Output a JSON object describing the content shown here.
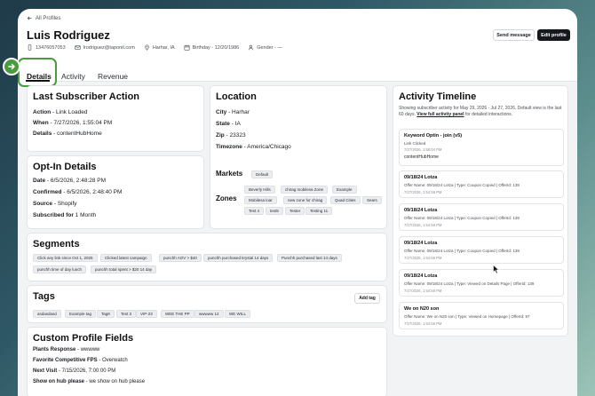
{
  "nav": {
    "back_label": "All Profiles"
  },
  "profile": {
    "name": "Luis Rodriguez",
    "phone": "13476057053",
    "email": "lrodriguez@taponit.com",
    "location": "Harhar, IA",
    "birthday": "Birthday - 12/20/1986",
    "gender": "Gender - —"
  },
  "actions": {
    "send_message": "Send message",
    "edit_profile": "Edit profile"
  },
  "tabs": [
    {
      "label": "Details"
    },
    {
      "label": "Activity"
    },
    {
      "label": "Revenue"
    }
  ],
  "last_action": {
    "title": "Last Subscriber Action",
    "rows": [
      {
        "key": "Action",
        "value": " - Link Loaded"
      },
      {
        "key": "When",
        "value": " - 7/27/2026, 1:55:04 PM"
      },
      {
        "key": "Details",
        "value": " - contentHubHome"
      }
    ]
  },
  "optin": {
    "title": "Opt-In Details",
    "rows": [
      {
        "key": "Date",
        "value": " - 6/5/2026, 2:48:28 PM"
      },
      {
        "key": "Confirmed",
        "value": " - 6/5/2026, 2:48:40 PM"
      },
      {
        "key": "Source",
        "value": " - Shopify"
      },
      {
        "key": "Subscribed for",
        "value": " 1 Month"
      }
    ]
  },
  "location": {
    "title": "Location",
    "rows": [
      {
        "key": "City",
        "value": " - Harhar"
      },
      {
        "key": "State",
        "value": " - IA"
      },
      {
        "key": "Zip",
        "value": " - 23323"
      },
      {
        "key": "Timezone",
        "value": " - America/Chicago"
      }
    ],
    "markets_label": "Markets",
    "markets": [
      "Default"
    ],
    "zones_label": "Zones",
    "zones": [
      "Beverly Hills",
      "chirag mobilesa Zone",
      "Example",
      "Mobilesa loar",
      "new zone for chirag",
      "Quad Cities",
      "Sears",
      "Test 4",
      "test5",
      "Tester",
      "Testing 11"
    ]
  },
  "segments": {
    "title": "Segments",
    "items": [
      "Click any link since Oct 1, 2025",
      "Clicked latest campaign",
      "punchh AOV > $40",
      "punchh purchased krystal 14 days",
      "Punchh purchased last 14 days",
      "punchh time of day lunch",
      "punchh total spent > $20 14 day"
    ]
  },
  "tags": {
    "title": "Tags",
    "add_label": "Add tag",
    "items": [
      "asdasdasd",
      "Example tag",
      "Tag8",
      "Test 3",
      "VIP-23",
      "WEE THE PP",
      "wwwww 12",
      "WE WILL"
    ]
  },
  "custom": {
    "title": "Custom Profile Fields",
    "rows": [
      {
        "key": "Plants Response",
        "value": " - wwwww"
      },
      {
        "key": "Favorite Competitive FPS",
        "value": " - Overwatch"
      },
      {
        "key": "Next Visit",
        "value": " - 7/15/2026, 7:00:00 PM"
      },
      {
        "key": "Show on hub please",
        "value": " - we show on hub please"
      }
    ]
  },
  "timeline": {
    "title": "Activity Timeline",
    "desc_prefix": "Showing subscriber activity for May 29, 2026 - Jul 27, 2026. Default view is the last 60 days. ",
    "desc_link": "View full activity panel",
    "desc_suffix": " for detailed interactions.",
    "items": [
      {
        "title": "Keyword Optin - join (v5)",
        "lines": [
          "Link Clicked",
          "7/27/2026, 1:55:04 PM",
          "contentHubHome"
        ]
      },
      {
        "title": "09/18/24 Lotza",
        "lines": [
          "Offer Name: 09/18/24 Lotza | Type: Coupon Copied | OfferId: 139",
          "7/27/2026, 1:54:58 PM"
        ]
      },
      {
        "title": "09/18/24 Lotza",
        "lines": [
          "Offer Name: 09/18/24 Lotza | Type: Coupon Copied | OfferId: 139",
          "7/27/2026, 1:54:58 PM"
        ]
      },
      {
        "title": "09/18/24 Lotza",
        "lines": [
          "Offer Name: 09/18/24 Lotza | Type: Coupon Copied | OfferId: 139",
          "7/27/2026, 1:54:58 PM"
        ]
      },
      {
        "title": "09/18/24 Lotza",
        "lines": [
          "Offer Name: 09/18/24 Lotza | Type: Viewed on Details Page | OfferId: 139",
          "7/27/2026, 1:54:58 PM"
        ]
      },
      {
        "title": "We on N20 son",
        "lines": [
          "Offer Name: We on N20 son | Type: Viewed on Homepage | OfferId: 97",
          "7/27/2026, 1:54:58 PM"
        ]
      }
    ]
  },
  "colors": {
    "accent_green": "#4a9b3f",
    "primary_dark": "#15181c"
  }
}
